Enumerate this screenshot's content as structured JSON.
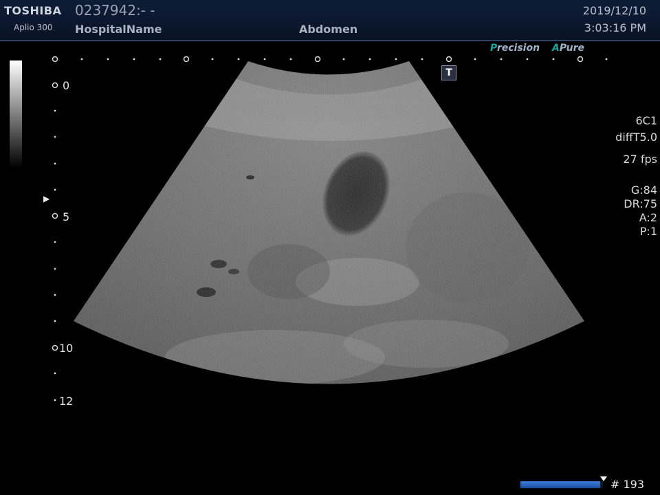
{
  "header": {
    "brand": "TOSHIBA",
    "model": "Aplio 300",
    "patient_id": "0237942:- -",
    "hospital": "HospitalName",
    "exam": "Abdomen",
    "date": "2019/12/10",
    "time": "3:03:16 PM"
  },
  "badges": {
    "precision_lead": "P",
    "precision_rest": "recision",
    "apure_lead": "A",
    "apure_rest": "Pure"
  },
  "depth_scale": {
    "labels": [
      "0",
      "5",
      "10",
      "12"
    ]
  },
  "params": {
    "probe": "6C1",
    "mode": "diffT5.0",
    "fps": "27 fps",
    "gain": "G:84",
    "dr": "DR:75",
    "a": "A:2",
    "p": "P:1"
  },
  "controls": {
    "t_label": "T"
  },
  "cine": {
    "frame_label": "# 193",
    "position_fraction": 0.97
  },
  "colors": {
    "header_bg": "#0b1730",
    "accent_teal": "#1aa7a1",
    "progress_blue": "#2a66c0"
  }
}
